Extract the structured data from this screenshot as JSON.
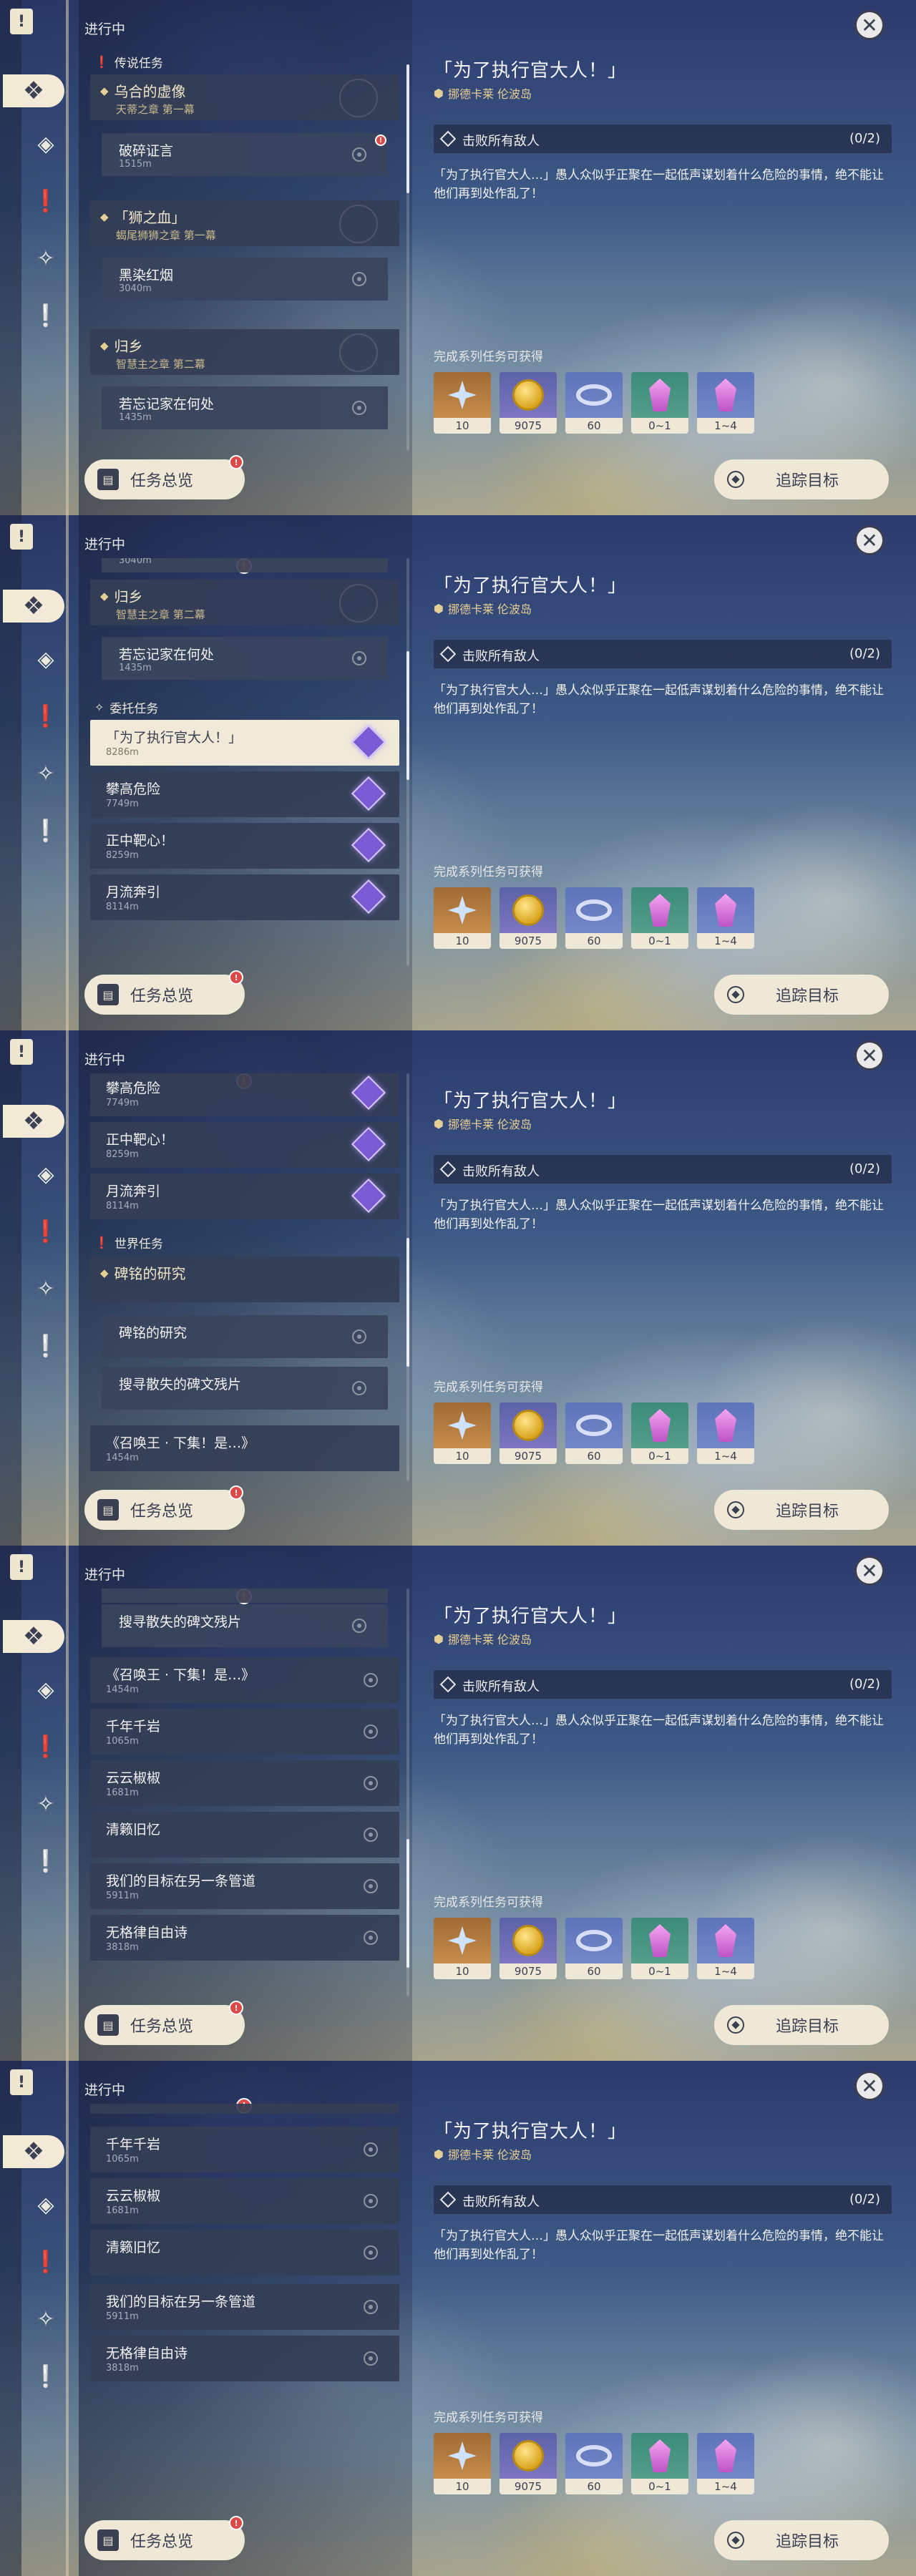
{
  "header": {
    "progress_label": "进行中"
  },
  "sections": {
    "legend": "传说任务",
    "commission": "委托任务",
    "world": "世界任务"
  },
  "legend_quests": [
    {
      "title": "乌合的虚像",
      "subtitle": "天蒂之章 第一幕",
      "subquest": {
        "title": "破碎证言",
        "distance": "1515m"
      }
    },
    {
      "title": "「狮之血」",
      "subtitle": "蝎尾狮狮之章 第一幕",
      "subquest": {
        "title": "黑染红烟",
        "distance": "3040m"
      }
    },
    {
      "title": "归乡",
      "subtitle": "智慧主之章 第二幕",
      "subquest": {
        "title": "若忘记家在何处",
        "distance": "1435m"
      }
    }
  ],
  "commissions": [
    {
      "title": "「为了执行官大人！」",
      "distance": "8286m"
    },
    {
      "title": "攀高危险",
      "distance": "7749m"
    },
    {
      "title": "正中靶心！",
      "distance": "8259m"
    },
    {
      "title": "月流奔引",
      "distance": "8114m"
    }
  ],
  "world": {
    "stele": {
      "title": "碑铭的研究",
      "sub1": "碑铭的研究",
      "sub2": "搜寻散失的碑文残片"
    },
    "list": [
      {
        "title": "《召唤王 · 下集！是…》",
        "distance": "1454m"
      },
      {
        "title": "千年千岩",
        "distance": "1065m"
      },
      {
        "title": "云云椒椒",
        "distance": "1681m"
      },
      {
        "title": "清籁旧忆",
        "distance": ""
      },
      {
        "title": "我们的目标在另一条管道",
        "distance": "5911m"
      },
      {
        "title": "无格律自由诗",
        "distance": "3818m"
      }
    ]
  },
  "alert_mark": "!",
  "overview_button": {
    "label": "任务总览",
    "badge": "!"
  },
  "track_button": {
    "label": "追踪目标"
  },
  "close_glyph": "✕",
  "detail": {
    "title": "「为了执行官大人！」",
    "region": "挪德卡莱 伦波岛",
    "objective": {
      "text": "击败所有敌人",
      "count": "(0/2)"
    },
    "description": "「为了执行官大人…」愚人众似乎正聚在一起低声谋划着什么危险的事情，绝不能让他们再到处作乱了！",
    "rewards_label": "完成系列任务可获得",
    "rewards": [
      {
        "icon": "primogem-icon",
        "qty": "10"
      },
      {
        "icon": "mora-icon",
        "qty": "9075"
      },
      {
        "icon": "adventure-exp-icon",
        "qty": "60"
      },
      {
        "icon": "crystal-chunk-icon",
        "qty": "0~1"
      },
      {
        "icon": "crystal-cluster-icon",
        "qty": "1~4"
      }
    ]
  },
  "colors": {
    "accent": "#efe8d6",
    "alert": "#e04848",
    "gold_text": "#e6cf92"
  }
}
